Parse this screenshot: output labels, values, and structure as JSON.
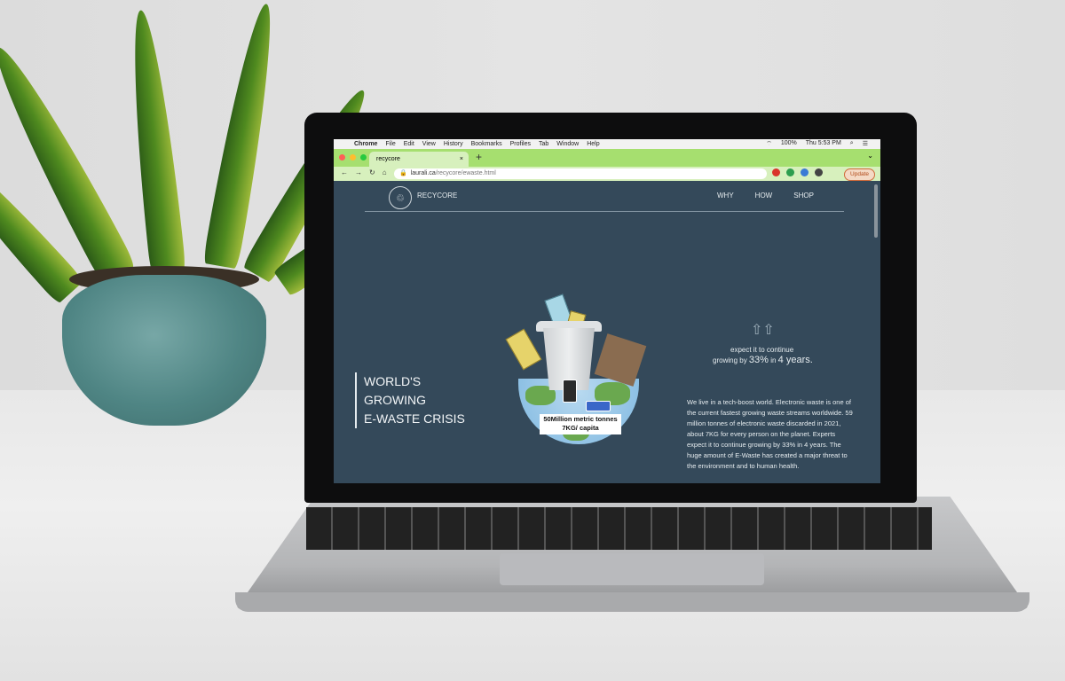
{
  "menubar": {
    "items": [
      "Chrome",
      "File",
      "Edit",
      "View",
      "History",
      "Bookmarks",
      "Profiles",
      "Tab",
      "Window",
      "Help"
    ],
    "battery": "100%",
    "clock": "Thu 5:53 PM"
  },
  "browser": {
    "tab_title": "recycore",
    "tab_close": "×",
    "new_tab": "+",
    "url_host": "laurali.ca",
    "url_path": "/recycore/ewaste.html",
    "update_label": "Update"
  },
  "site": {
    "brand": "RECYCORE",
    "nav": [
      "WHY",
      "HOW",
      "SHOP"
    ],
    "headline": [
      "WORLD'S",
      "GROWING",
      "E-WASTE CRISIS"
    ],
    "stat_line1": "expect it to continue",
    "stat_line2_prefix": "growing by",
    "stat_highlight": "33%",
    "stat_line2_mid": "in",
    "stat_years": "4 years.",
    "illustration_label_1": "50Million metric tonnes",
    "illustration_label_2": "7KG/ capita",
    "paragraph": "We live in a tech-boost world. Electronic waste is one of the current fastest growing waste streams worldwide. 59 million tonnes of electronic waste discarded in 2021, about 7KG for every person on the planet. Experts expect it to continue growing by 33% in 4 years. The huge amount of E-Waste has created a major threat to the environment and to human health."
  },
  "colors": {
    "site_bg": "#34495a",
    "chrome_accent": "#a6df6f",
    "pot": "#4f8584"
  }
}
